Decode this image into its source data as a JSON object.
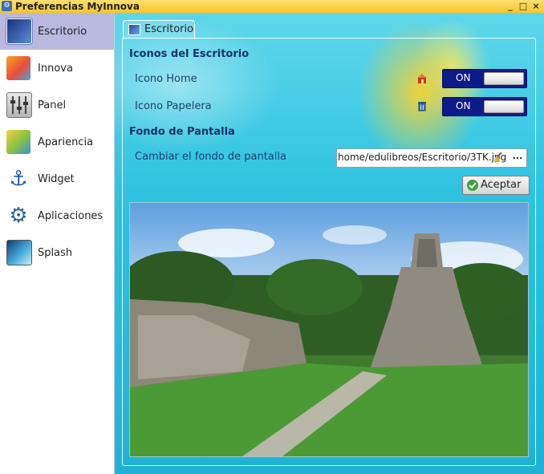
{
  "window": {
    "title": "Preferencias MyInnova",
    "controls": [
      "_",
      "□",
      "×"
    ]
  },
  "sidebar": {
    "items": [
      {
        "label": "Escritorio",
        "icon": "desktop-icon",
        "selected": true
      },
      {
        "label": "Innova",
        "icon": "innova-icon",
        "selected": false
      },
      {
        "label": "Panel",
        "icon": "sliders-icon",
        "selected": false
      },
      {
        "label": "Apariencia",
        "icon": "appearance-icon",
        "selected": false
      },
      {
        "label": "Widget",
        "icon": "anchor-icon",
        "selected": false
      },
      {
        "label": "Aplicaciones",
        "icon": "gear-icon",
        "selected": false
      },
      {
        "label": "Splash",
        "icon": "splash-icon",
        "selected": false
      }
    ]
  },
  "tab": {
    "label": "Escritorio"
  },
  "desktop_icons": {
    "title": "Iconos del Escritorio",
    "home": {
      "label": "Icono Home",
      "state": "ON",
      "icon": "home-icon"
    },
    "trash": {
      "label": "Icono Papelera",
      "state": "ON",
      "icon": "trash-icon"
    }
  },
  "wallpaper": {
    "title": "Fondo de Pantalla",
    "change_label": "Cambiar el fondo de pantalla",
    "path": "home/edulibreos/Escritorio/3TK.jpg",
    "clear_icon": "broom-icon",
    "browse_label": "...",
    "accept_label": "Aceptar",
    "preview_image": "wallpaper-preview"
  },
  "colors": {
    "selected_item": "#b9b9e0",
    "toggle_bg": "#0d1a8a",
    "title_bar": "#f7c52a",
    "section_title": "#11336a"
  }
}
